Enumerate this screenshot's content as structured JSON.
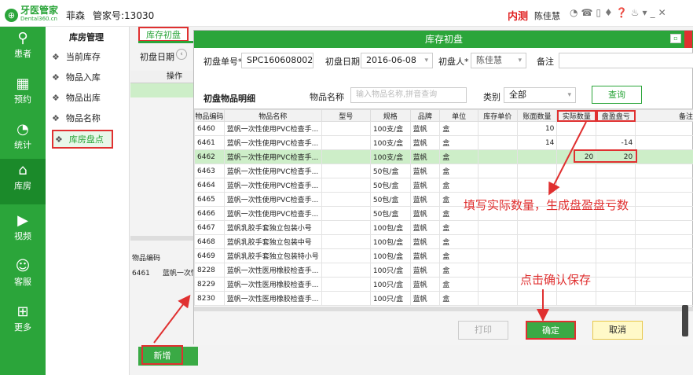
{
  "topbar": {
    "logo_text": "牙医管家",
    "logo_sub": "Dental360.cn",
    "user": "菲森",
    "manager_id": "管家号:13030",
    "env_label": "内测",
    "user_name": "陈佳慧",
    "icons": [
      "chat-icon",
      "phone-icon",
      "tablet-icon",
      "bell-icon",
      "help-icon",
      "shirt-icon",
      "dropdown-icon",
      "minimize-icon",
      "close-icon"
    ]
  },
  "leftnav": [
    {
      "icon": "patient-icon",
      "label": "患者"
    },
    {
      "icon": "calendar-icon",
      "label": "预约"
    },
    {
      "icon": "chart-icon",
      "label": "统计"
    },
    {
      "icon": "house-icon",
      "label": "库房"
    },
    {
      "icon": "play-icon",
      "label": "视频"
    },
    {
      "icon": "support-icon",
      "label": "客服"
    },
    {
      "icon": "grid-icon",
      "label": "更多"
    }
  ],
  "subnav": {
    "title": "库房管理",
    "items": [
      "当前库存",
      "物品入库",
      "物品出库",
      "物品名称",
      "库房盘点"
    ]
  },
  "background": {
    "tab": "库存初盘",
    "date_label": "初盘日期",
    "col_op": "操作",
    "col_code": "物品编码",
    "row_code": "6461",
    "row_name": "蓝帆一次性",
    "new_button": "新增"
  },
  "modal": {
    "title": "库存初盘",
    "order_label": "初盘单号*",
    "order_value": "SPC160608002",
    "date_label": "初盘日期",
    "date_value": "2016-06-08",
    "person_label": "初盘人*",
    "person_value": "陈佳慧",
    "note_label": "备注",
    "section_title": "初盘物品明细",
    "name_label": "物品名称",
    "search_placeholder": "输入物品名称,拼音查询",
    "category_label": "类别",
    "category_value": "全部",
    "query_button": "查询",
    "columns": [
      "物品编码",
      "物品名称",
      "型号",
      "规格",
      "品牌",
      "单位",
      "库存单价",
      "账面数量",
      "实际数量",
      "盘盈盘亏",
      "备注"
    ],
    "rows": [
      [
        "6460",
        "蓝帆一次性使用PVC检查手...",
        "",
        "100支/盒",
        "蓝帆",
        "盒",
        "",
        "10",
        "",
        "",
        ""
      ],
      [
        "6461",
        "蓝帆一次性使用PVC检查手...",
        "",
        "100支/盒",
        "蓝帆",
        "盒",
        "",
        "14",
        "",
        "-14",
        ""
      ],
      [
        "6462",
        "蓝帆一次性使用PVC检查手...",
        "",
        "100支/盒",
        "蓝帆",
        "盒",
        "",
        "",
        "20",
        "20",
        ""
      ],
      [
        "6463",
        "蓝帆一次性使用PVC检查手...",
        "",
        "50包/盒",
        "蓝帆",
        "盒",
        "",
        "",
        "",
        "",
        ""
      ],
      [
        "6464",
        "蓝帆一次性使用PVC检查手...",
        "",
        "50包/盒",
        "蓝帆",
        "盒",
        "",
        "",
        "",
        "",
        ""
      ],
      [
        "6465",
        "蓝帆一次性使用PVC检查手...",
        "",
        "50包/盒",
        "蓝帆",
        "盒",
        "",
        "",
        "",
        "",
        ""
      ],
      [
        "6466",
        "蓝帆一次性使用PVC检查手...",
        "",
        "50包/盒",
        "蓝帆",
        "盒",
        "",
        "",
        "",
        "",
        ""
      ],
      [
        "6467",
        "蓝帆乳胶手套独立包装小号",
        "",
        "100包/盒",
        "蓝帆",
        "盒",
        "",
        "",
        "",
        "",
        ""
      ],
      [
        "6468",
        "蓝帆乳胶手套独立包装中号",
        "",
        "100包/盒",
        "蓝帆",
        "盒",
        "",
        "",
        "",
        "",
        ""
      ],
      [
        "6469",
        "蓝帆乳胶手套独立包装特小号",
        "",
        "100包/盒",
        "蓝帆",
        "盒",
        "",
        "",
        "",
        "",
        ""
      ],
      [
        "8228",
        "蓝帆一次性医用橡胶检查手...",
        "",
        "100只/盒",
        "蓝帆",
        "盒",
        "",
        "",
        "",
        "",
        ""
      ],
      [
        "8229",
        "蓝帆一次性医用橡胶检查手...",
        "",
        "100只/盒",
        "蓝帆",
        "盒",
        "",
        "",
        "",
        "",
        ""
      ],
      [
        "8230",
        "蓝帆一次性医用橡胶检查手...",
        "",
        "100只/盒",
        "蓝帆",
        "盒",
        "",
        "",
        "",
        "",
        ""
      ]
    ],
    "print_button": "打印",
    "confirm_button": "确定",
    "cancel_button": "取消"
  },
  "annotations": {
    "fill_tip": "填写实际数量，生成盘盈盘亏数",
    "save_tip": "点击确认保存"
  },
  "colors": {
    "brand": "#2ba53a",
    "annotation": "#e03030",
    "highlight_row": "#cdeec8"
  }
}
